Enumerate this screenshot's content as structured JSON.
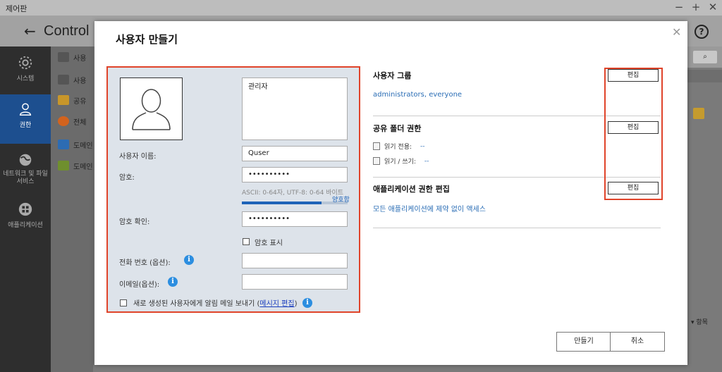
{
  "window": {
    "title": "제어판"
  },
  "header": {
    "title": "Control"
  },
  "rail": [
    {
      "label": "시스템",
      "icon": "gear-icon"
    },
    {
      "label": "권한",
      "icon": "user-icon",
      "active": true
    },
    {
      "label": "네트워크 및 파일 서비스",
      "icon": "globe-icon"
    },
    {
      "label": "애플리케이션",
      "icon": "apps-icon"
    }
  ],
  "sub": [
    {
      "label": "사용"
    },
    {
      "label": "사용"
    },
    {
      "label": "공유"
    },
    {
      "label": "전체"
    },
    {
      "label": "도메인"
    },
    {
      "label": "도메인"
    }
  ],
  "rstrip": {
    "items_label": "항목"
  },
  "dialog": {
    "title": "사용자 만들기",
    "description": "관리자",
    "username_label": "사용자 이름:",
    "username_value": "Quser",
    "password_label": "암호:",
    "password_value": "••••••••••",
    "password_hint": "ASCII: 0-64자, UTF-8: 0-64 바이트",
    "strength_label": "양호함",
    "strength_fraction": 0.75,
    "confirm_label": "암호 확인:",
    "confirm_value": "••••••••••",
    "show_password_label": "암호 표시",
    "phone_label": "전화 번호 (옵션):",
    "email_label": "이메일(옵션):",
    "notify_prefix": "새로 생성된 사용자에게 알림 메일 보내기 (",
    "notify_link": "메시지 편집",
    "notify_suffix": ")",
    "user_group_title": "사용자 그룹",
    "user_group_value": "administrators, everyone",
    "share_perm_title": "공유 폴더 권한",
    "read_only_label": "읽기 전용:",
    "read_only_value": "--",
    "read_write_label": "읽기 / 쓰기:",
    "read_write_value": "--",
    "app_perm_title": "애플리케이션 권한 편집",
    "app_perm_value": "모든 애플리케이션에 제약 없이 액세스",
    "edit_label": "편집",
    "create_label": "만들기",
    "cancel_label": "취소"
  }
}
